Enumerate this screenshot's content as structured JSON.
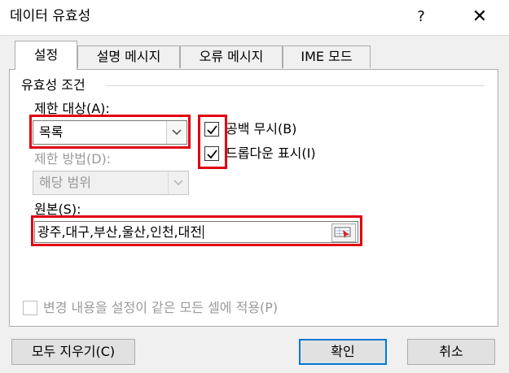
{
  "window": {
    "title": "데이터 유효성",
    "help": "?",
    "close": "✕"
  },
  "tabs": [
    {
      "label": "설정",
      "active": true
    },
    {
      "label": "설명 메시지",
      "active": false
    },
    {
      "label": "오류 메시지",
      "active": false
    },
    {
      "label": "IME 모드",
      "active": false
    }
  ],
  "validation": {
    "group_title": "유효성 조건",
    "allow_label": "제한 대상(A):",
    "allow_value": "목록",
    "ignore_blank_label": "공백 무시(B)",
    "ignore_blank_checked": true,
    "dropdown_label": "드롭다운 표시(I)",
    "dropdown_checked": true,
    "data_label": "제한 방법(D):",
    "data_value": "해당 범위",
    "source_label": "원본(S):",
    "source_value": "광주,대구,부산,울산,인천,대전",
    "apply_all_label": "변경 내용을 설정이 같은 모든 셀에 적용(P)",
    "apply_all_checked": false
  },
  "footer": {
    "clear_all": "모두 지우기(C)",
    "ok": "확인",
    "cancel": "취소"
  },
  "colors": {
    "highlight": "#e00012",
    "focus": "#0078d7"
  }
}
